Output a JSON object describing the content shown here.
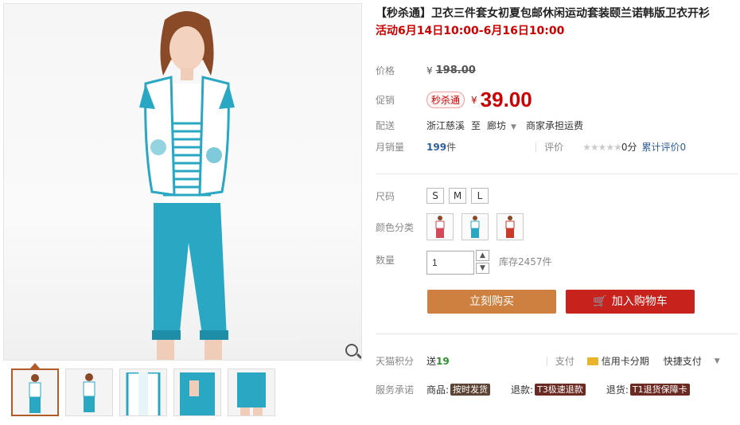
{
  "product": {
    "title": "【秒杀通】卫衣三件套女初夏包邮休闲运动套装颐兰诺韩版卫衣开衫",
    "promo": "活动6月14日10:00-6月16日10:00"
  },
  "price": {
    "label": "价格",
    "currency": "¥",
    "original": "198.00"
  },
  "promotion": {
    "label": "促销",
    "badge": "秒杀通",
    "currency": "¥",
    "price": "39.00"
  },
  "shipping": {
    "label": "配送",
    "from": "浙江慈溪",
    "to_word": "至",
    "destination": "廊坊",
    "note": "商家承担运费"
  },
  "sales": {
    "label": "月销量",
    "count": "199",
    "unit": "件",
    "rating_label": "评价",
    "rating_score": "0分",
    "review_text": "累计评价",
    "review_count": "0"
  },
  "size": {
    "label": "尺码",
    "options": [
      "S",
      "M",
      "L"
    ]
  },
  "color": {
    "label": "颜色分类"
  },
  "quantity": {
    "label": "数量",
    "value": "1",
    "stock": "库存2457件"
  },
  "actions": {
    "buy_now": "立刻购买",
    "add_cart": "加入购物车"
  },
  "points": {
    "label": "天猫积分",
    "send_word": "送",
    "value": "19",
    "pay_label": "支付",
    "credit": "信用卡分期",
    "quick_pay": "快捷支付"
  },
  "service": {
    "label": "服务承诺",
    "goods_word": "商品:",
    "goods_tag": "按时发货",
    "refund_word": "退款:",
    "refund_tag": "T3极速退款",
    "return_word": "退货:",
    "return_tag": "T1退货保障卡"
  },
  "colors": {
    "accent_red": "#cc0000",
    "buy_button": "#cd8040",
    "cart_button": "#c8221d",
    "teal": "#2aa7c2"
  }
}
